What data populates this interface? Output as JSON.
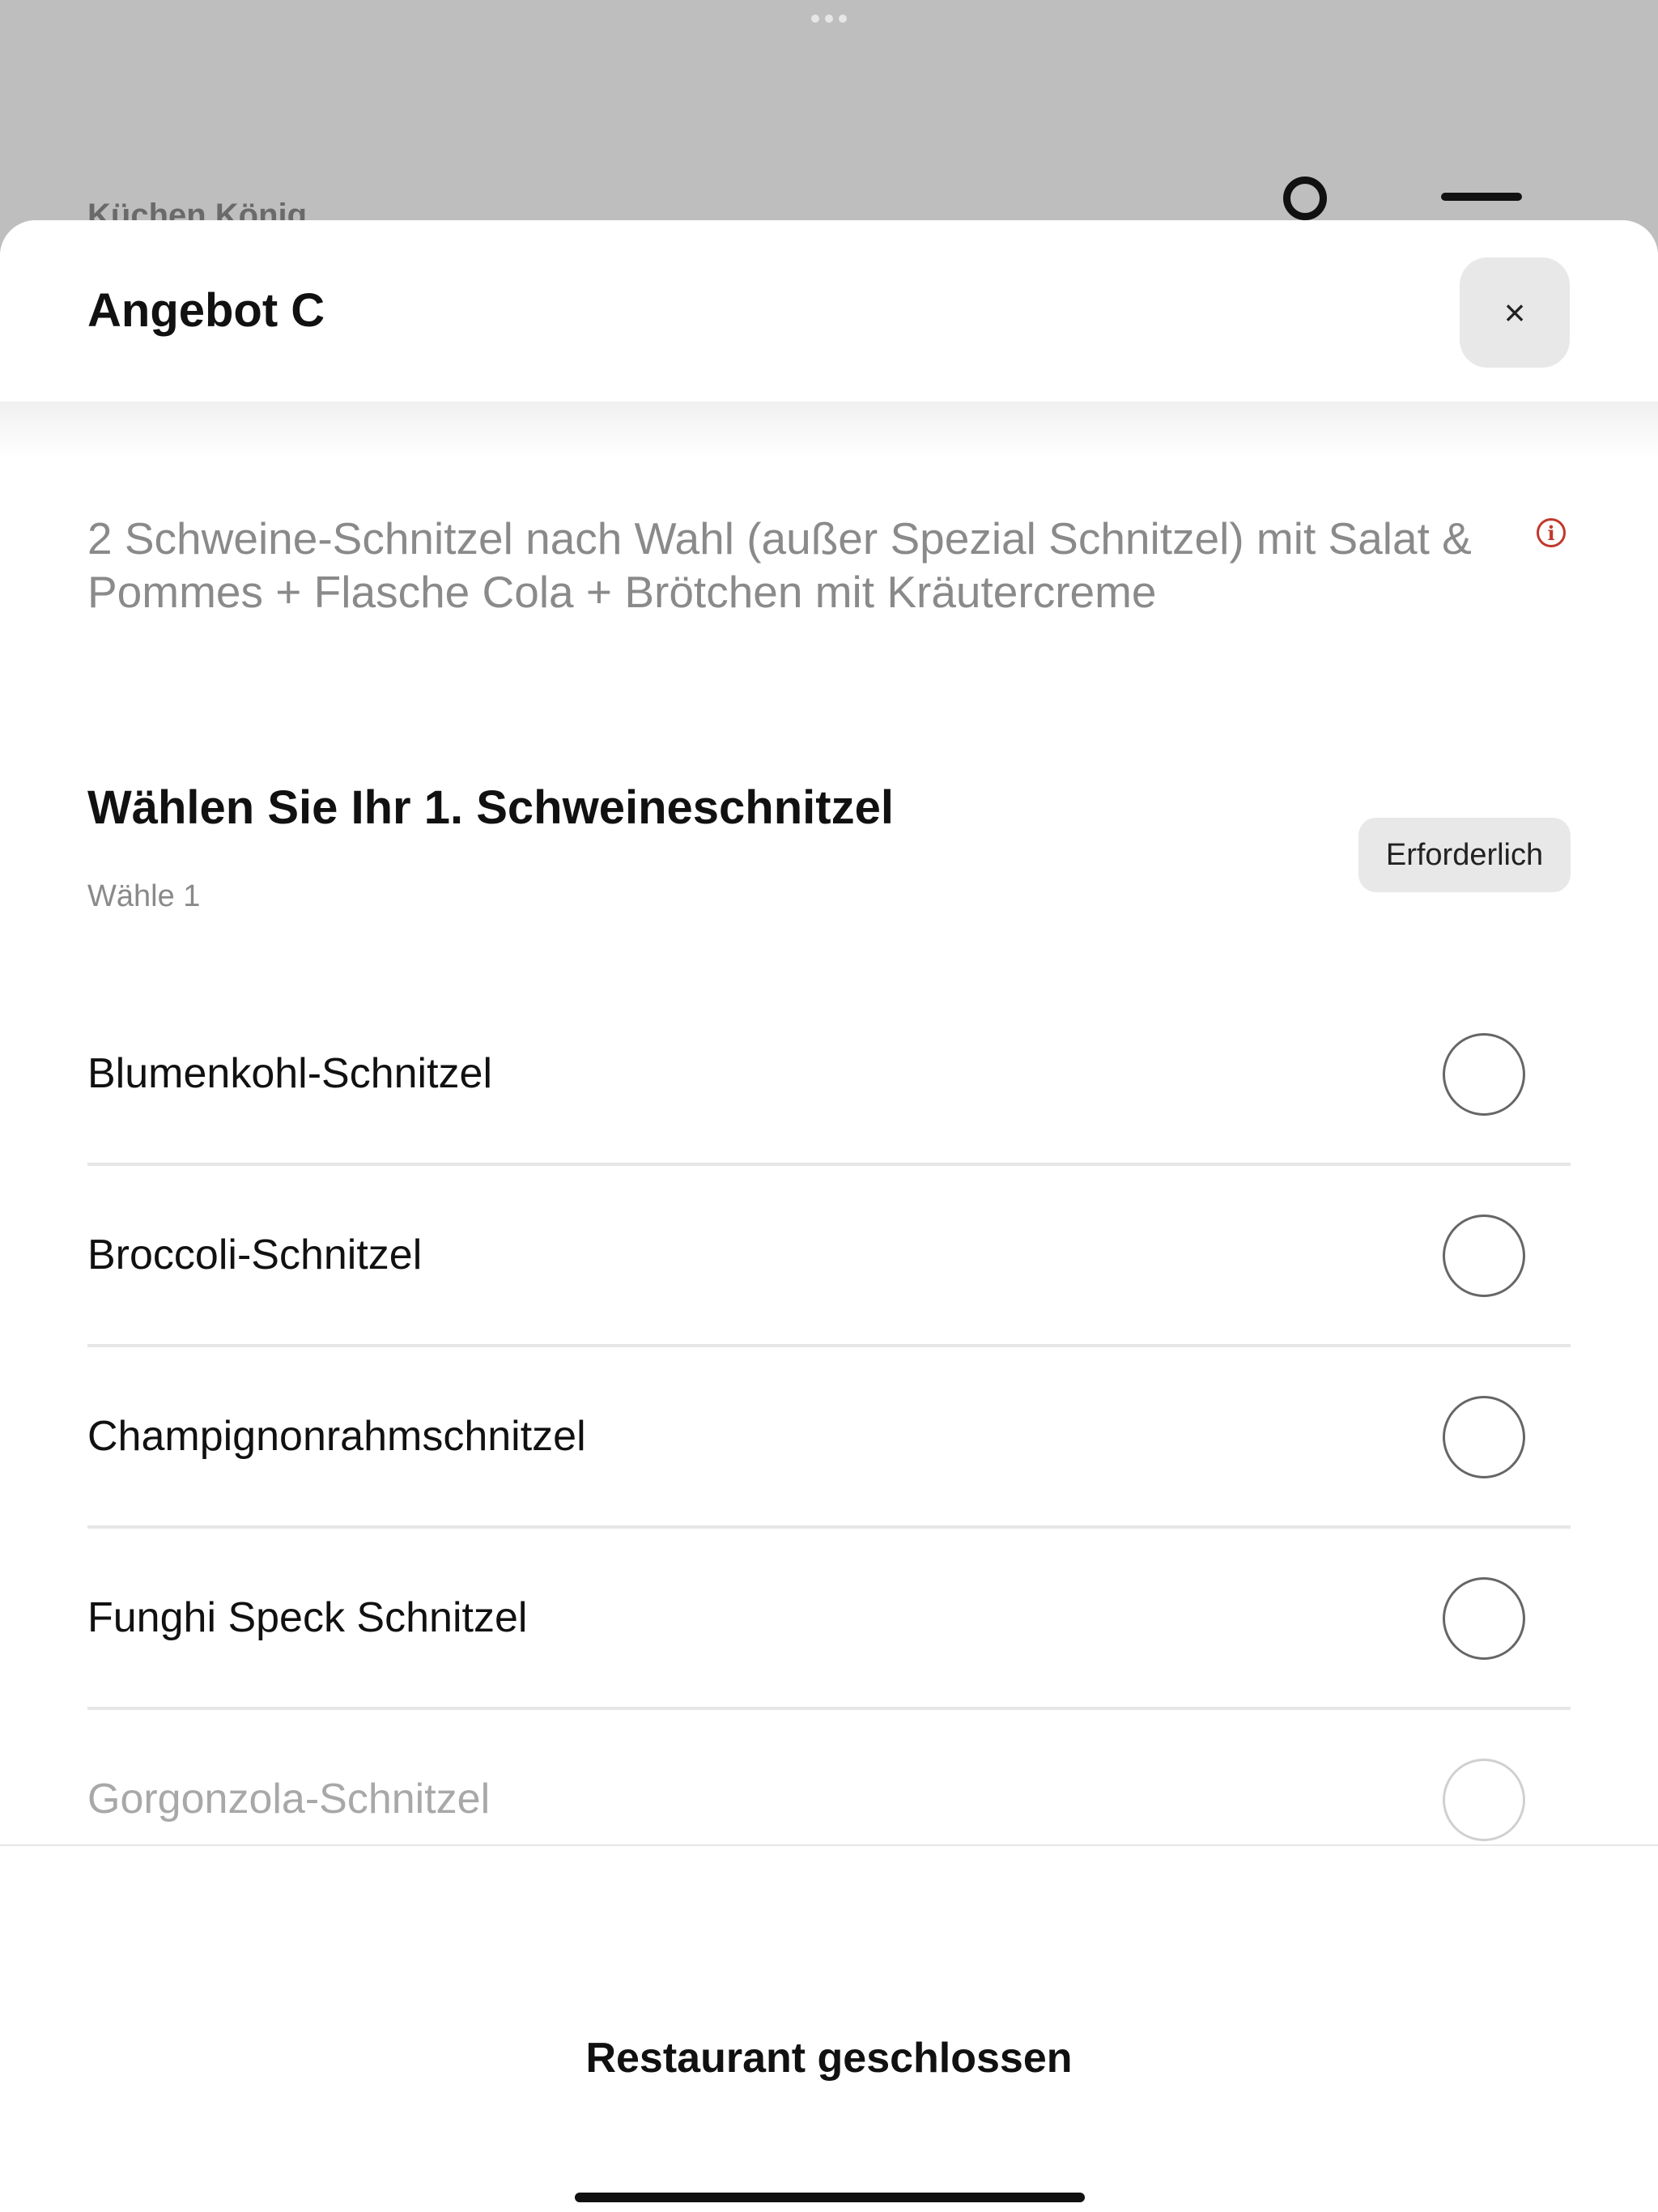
{
  "background_page": {
    "title": "Küchen König"
  },
  "sheet": {
    "title": "Angebot C",
    "close_label": "×",
    "description": "2 Schweine-Schnitzel nach Wahl (außer Spezial Schnitzel) mit Salat & Pommes + Flasche Cola + Brötchen mit Kräutercreme",
    "info_symbol": "i"
  },
  "section": {
    "title": "Wählen Sie Ihr 1. Schweineschnitzel",
    "subtitle": "Wähle 1",
    "required_badge": "Erforderlich"
  },
  "options": [
    {
      "label": "Blumenkohl-Schnitzel"
    },
    {
      "label": "Broccoli-Schnitzel"
    },
    {
      "label": "Champignonrahmschnitzel"
    },
    {
      "label": "Funghi Speck Schnitzel"
    },
    {
      "label": "Gorgonzola-Schnitzel"
    }
  ],
  "footer": {
    "status": "Restaurant geschlossen"
  },
  "colors": {
    "accent_info": "#c0392b",
    "overlay_bg": "#bebebe",
    "badge_bg": "#e8e8e8"
  }
}
